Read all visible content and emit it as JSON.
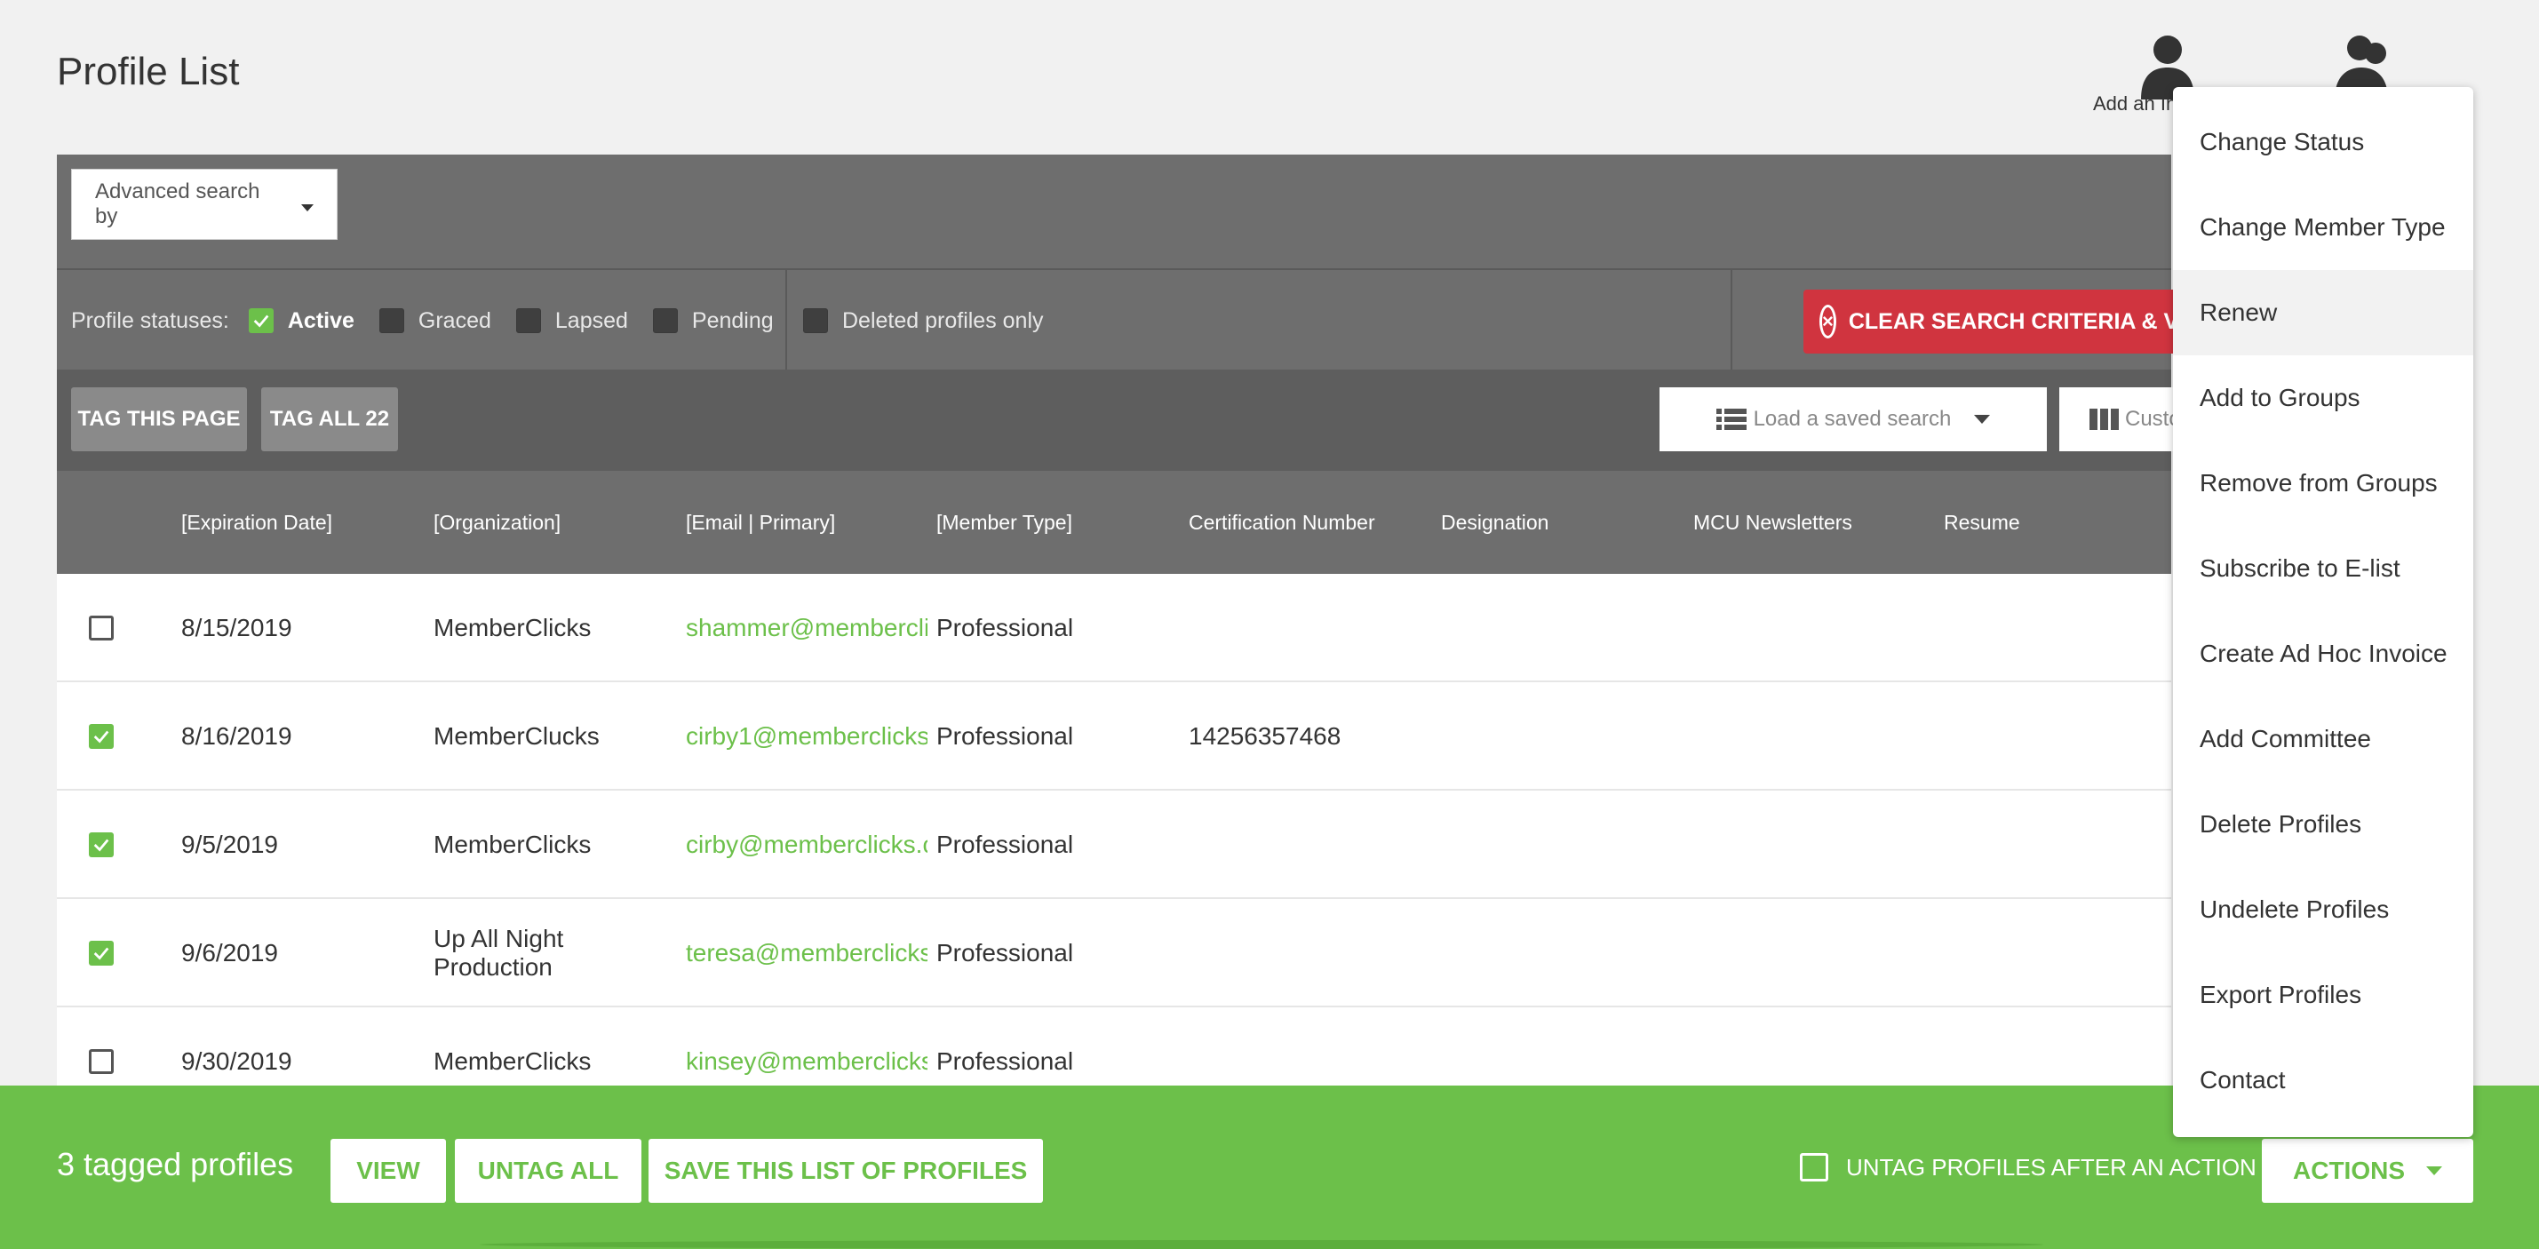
{
  "page": {
    "title": "Profile List",
    "add_individual_label": "Add an In"
  },
  "search": {
    "advanced_label": "Advanced search by"
  },
  "statuses": {
    "label": "Profile statuses:",
    "items": [
      {
        "label": "Active",
        "checked": true
      },
      {
        "label": "Graced",
        "checked": false
      },
      {
        "label": "Lapsed",
        "checked": false
      },
      {
        "label": "Pending",
        "checked": false
      }
    ],
    "deleted_only_label": "Deleted profiles only",
    "clear_label": "CLEAR SEARCH CRITERIA & VIEW ALL"
  },
  "tagbar": {
    "tag_page": "TAG THIS PAGE",
    "tag_all": "TAG ALL 22",
    "load_saved_search": "Load a saved search",
    "customize_columns": "Custo"
  },
  "table": {
    "columns": [
      "[Expiration Date]",
      "[Organization]",
      "[Email | Primary]",
      "[Member Type]",
      "Certification Number",
      "Designation",
      "MCU Newsletters",
      "Resume"
    ],
    "rows": [
      {
        "checked": false,
        "expiration": "8/15/2019",
        "organization": "MemberClicks",
        "email": "shammer@memberclicks",
        "member_type": "Professional",
        "cert": ""
      },
      {
        "checked": true,
        "expiration": "8/16/2019",
        "organization": "MemberClucks",
        "email": "cirby1@memberclicks.",
        "member_type": "Professional",
        "cert": "14256357468"
      },
      {
        "checked": true,
        "expiration": "9/5/2019",
        "organization": "MemberClicks",
        "email": "cirby@memberclicks.c",
        "member_type": "Professional",
        "cert": ""
      },
      {
        "checked": true,
        "expiration": "9/6/2019",
        "organization": "Up All Night Production",
        "email": "teresa@memberclicks.",
        "member_type": "Professional",
        "cert": ""
      },
      {
        "checked": false,
        "expiration": "9/30/2019",
        "organization": "MemberClicks",
        "email": "kinsey@memberclicks.",
        "member_type": "Professional",
        "cert": ""
      }
    ]
  },
  "footer": {
    "tagged_count": "3 tagged profiles",
    "view": "VIEW",
    "untag_all": "UNTAG ALL",
    "save_list": "SAVE THIS LIST OF PROFILES",
    "untag_after_action": "UNTAG PROFILES AFTER AN ACTION",
    "actions": "ACTIONS"
  },
  "actions_menu": {
    "items": [
      "Change Status",
      "Change Member Type",
      "Renew",
      "Add to Groups",
      "Remove from Groups",
      "Subscribe to E-list",
      "Create Ad Hoc Invoice",
      "Add Committee",
      "Delete Profiles",
      "Undelete Profiles",
      "Export Profiles",
      "Contact"
    ],
    "hovered": "Renew"
  },
  "colors": {
    "brand_green": "#6cc04a",
    "danger_red": "#d0343f",
    "header_gray": "#6e6e6e"
  }
}
